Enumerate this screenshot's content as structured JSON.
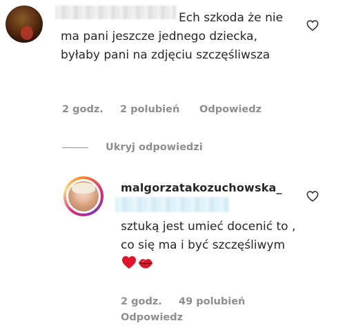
{
  "comment": {
    "text": "Ech szkoda że nie ma pani jeszcze jednego dziecka, byłaby pani na zdjęciu szczęśliwsza",
    "time": "2 godz.",
    "likes": "2 polubień",
    "reply_label": "Odpowiedz",
    "like_icon": "heart-outline-icon"
  },
  "hide_replies_label": "Ukryj odpowiedzi",
  "reply": {
    "username": "malgorzatakozuchowska_",
    "text": "sztuką jest umieć docenić to , co się ma i być szczęśliwym",
    "emojis": [
      "red-heart-emoji",
      "kiss-mark-emoji"
    ],
    "time": "2 godz.",
    "likes": "49 polubień",
    "reply_label": "Odpowiedz",
    "like_icon": "heart-outline-icon"
  },
  "colors": {
    "text": "#262626",
    "secondary": "#8e8e8e",
    "mention_blur": "#d7f0f8"
  }
}
